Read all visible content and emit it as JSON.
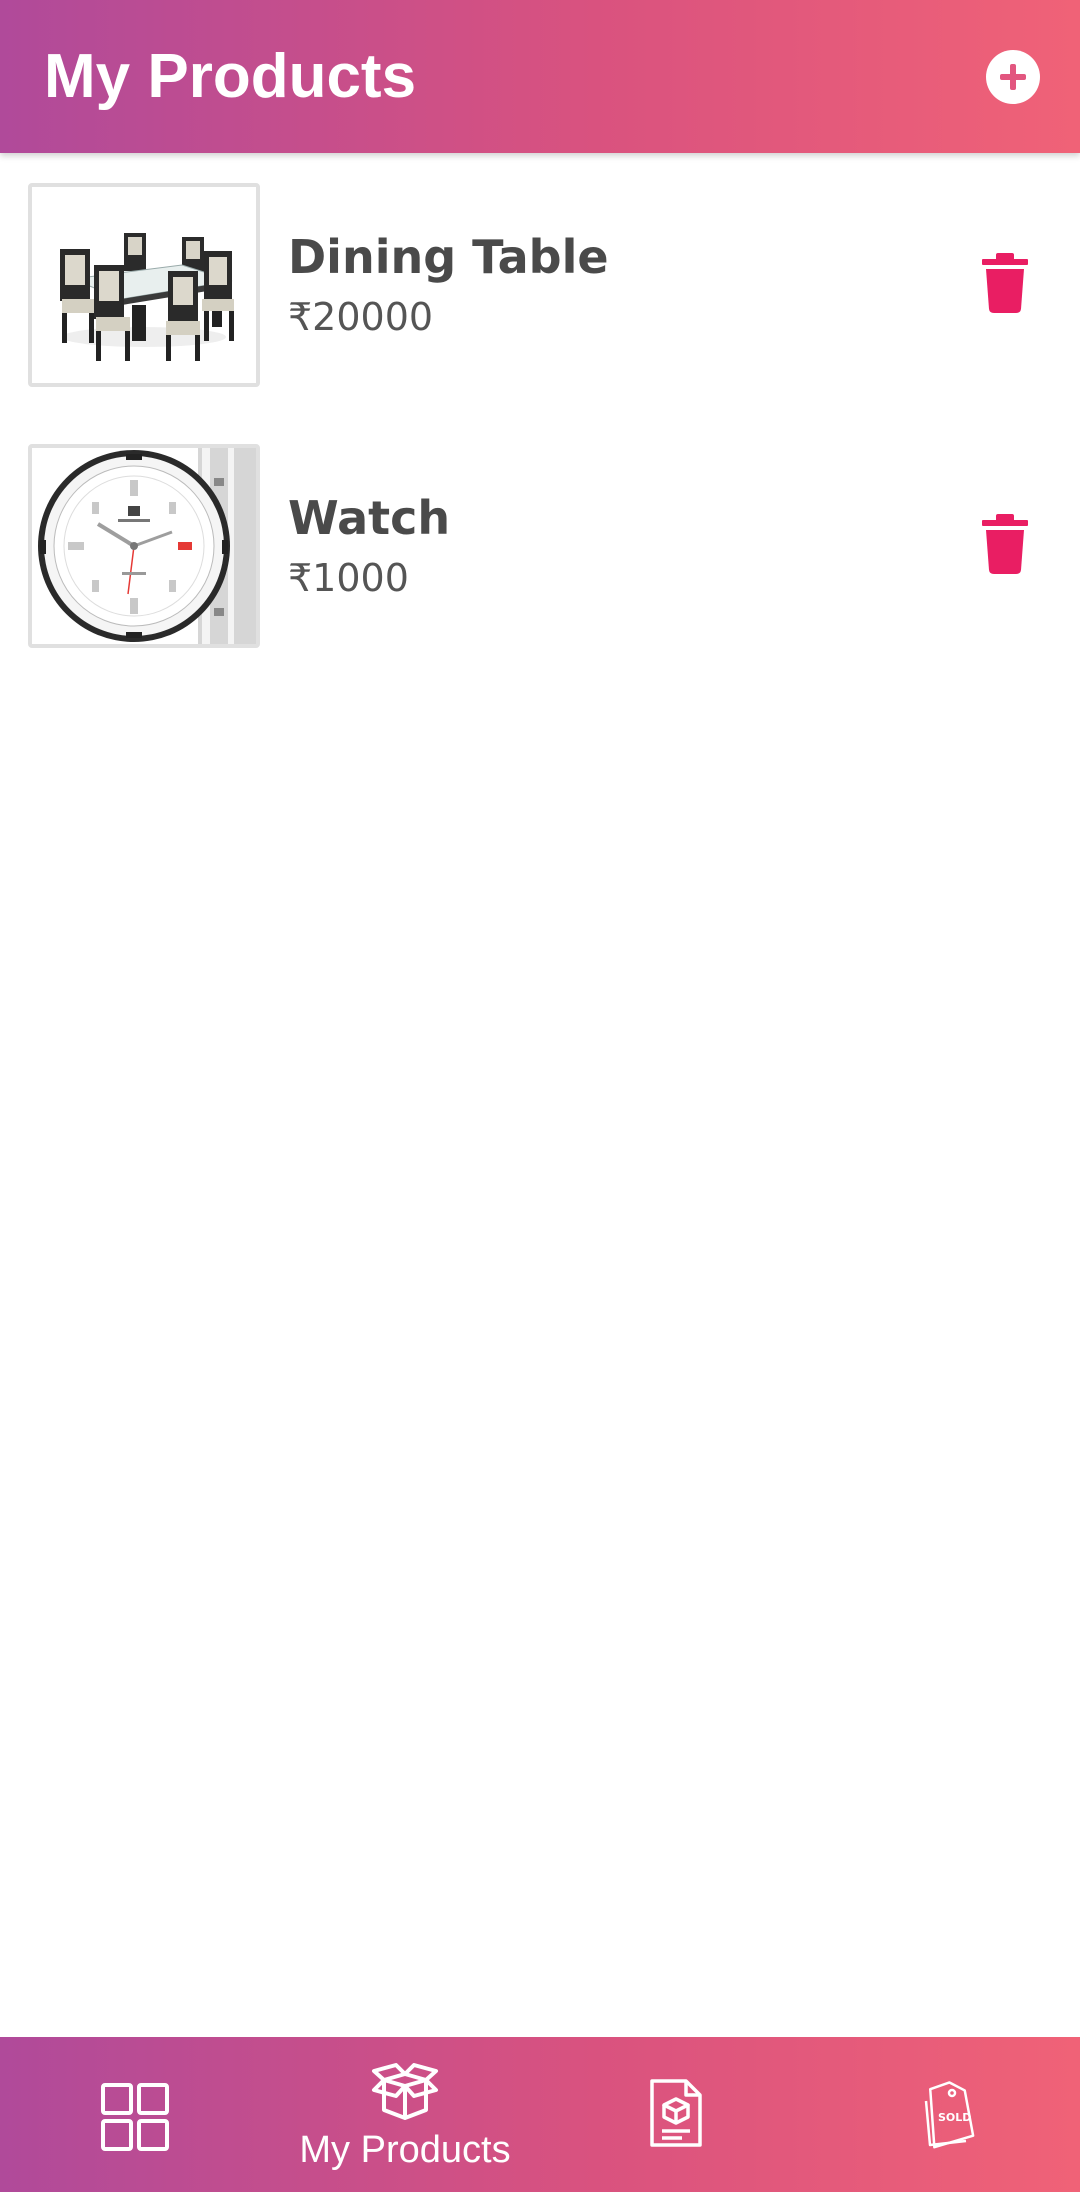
{
  "app_bar": {
    "title": "My Products",
    "add_icon": "add-circle-icon",
    "gradient_start": "#b04a9a",
    "gradient_end": "#f06277"
  },
  "products": [
    {
      "name": "Dining Table",
      "price": "₹20000",
      "image": "dining-table-image"
    },
    {
      "name": "Watch",
      "price": "₹1000",
      "image": "watch-image"
    }
  ],
  "delete_icon": "trash-icon",
  "delete_color": "#e91e63",
  "bottom_nav": {
    "items": [
      {
        "id": "dashboard",
        "icon": "grid-icon",
        "label": ""
      },
      {
        "id": "my-products",
        "icon": "box-icon",
        "label": "My Products",
        "active": true
      },
      {
        "id": "orders",
        "icon": "document-box-icon",
        "label": ""
      },
      {
        "id": "sold",
        "icon": "sold-tag-icon",
        "label": ""
      }
    ]
  }
}
